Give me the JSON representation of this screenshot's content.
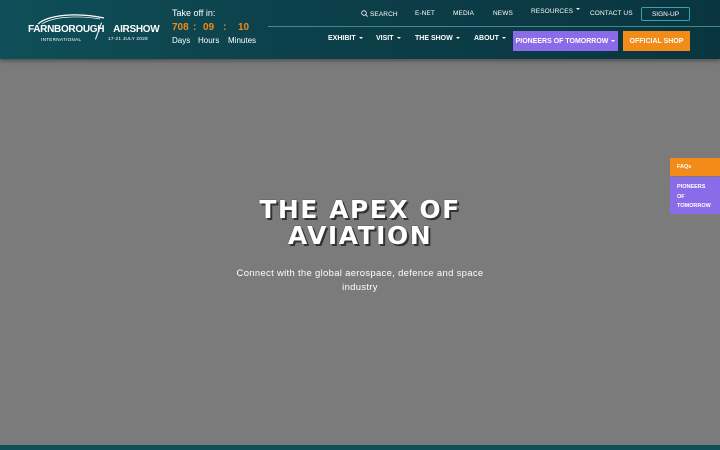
{
  "logo": {
    "line1": "FARNBOROUGH",
    "line1b": "AIRSHOW",
    "line2": "INTERNATIONAL",
    "line3": "17-21 JULY 2028"
  },
  "countdown": {
    "title": "Take off in:",
    "days": "708",
    "hours": "09",
    "minutes": "10",
    "separator": ":",
    "days_label": "Days",
    "hours_label": "Hours",
    "minutes_label": "Minutes"
  },
  "top_nav": {
    "search": "SEARCH",
    "enet": "E-NET",
    "media": "MEDIA",
    "news": "NEWS",
    "resources": "RESOURCES",
    "contact": "CONTACT US",
    "signup": "SIGN-UP"
  },
  "main_nav": {
    "exhibit": "EXHIBIT",
    "visit": "VISIT",
    "the_show": "THE SHOW",
    "about": "ABOUT",
    "pioneers": "PIONEERS OF TOMORROW",
    "shop": "OFFICIAL SHOP"
  },
  "hero": {
    "title_line1": "THE APEX OF",
    "title_line2": "AVIATION",
    "subtitle": "Connect with the global aerospace, defence and space industry"
  },
  "side_tabs": {
    "faqs": "FAQs",
    "pioneers_1": "PIONEERS",
    "pioneers_2": "OF",
    "pioneers_3": "TOMORROW"
  },
  "colors": {
    "header": "#0c3f49",
    "accent_orange": "#f28b18",
    "accent_purple": "#8a6ce8",
    "hero_bg": "#7b7b7b"
  }
}
